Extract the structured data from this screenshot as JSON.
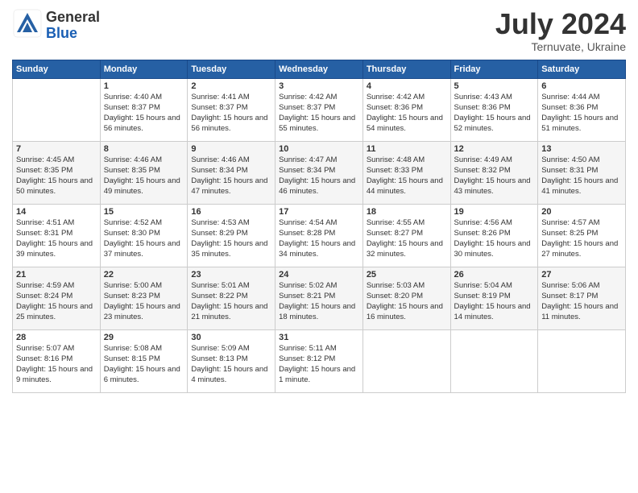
{
  "logo": {
    "general": "General",
    "blue": "Blue"
  },
  "title": {
    "month_year": "July 2024",
    "location": "Ternuvate, Ukraine"
  },
  "weekdays": [
    "Sunday",
    "Monday",
    "Tuesday",
    "Wednesday",
    "Thursday",
    "Friday",
    "Saturday"
  ],
  "weeks": [
    [
      {
        "day": "",
        "sunrise": "",
        "sunset": "",
        "daylight": ""
      },
      {
        "day": "1",
        "sunrise": "Sunrise: 4:40 AM",
        "sunset": "Sunset: 8:37 PM",
        "daylight": "Daylight: 15 hours and 56 minutes."
      },
      {
        "day": "2",
        "sunrise": "Sunrise: 4:41 AM",
        "sunset": "Sunset: 8:37 PM",
        "daylight": "Daylight: 15 hours and 56 minutes."
      },
      {
        "day": "3",
        "sunrise": "Sunrise: 4:42 AM",
        "sunset": "Sunset: 8:37 PM",
        "daylight": "Daylight: 15 hours and 55 minutes."
      },
      {
        "day": "4",
        "sunrise": "Sunrise: 4:42 AM",
        "sunset": "Sunset: 8:36 PM",
        "daylight": "Daylight: 15 hours and 54 minutes."
      },
      {
        "day": "5",
        "sunrise": "Sunrise: 4:43 AM",
        "sunset": "Sunset: 8:36 PM",
        "daylight": "Daylight: 15 hours and 52 minutes."
      },
      {
        "day": "6",
        "sunrise": "Sunrise: 4:44 AM",
        "sunset": "Sunset: 8:36 PM",
        "daylight": "Daylight: 15 hours and 51 minutes."
      }
    ],
    [
      {
        "day": "7",
        "sunrise": "Sunrise: 4:45 AM",
        "sunset": "Sunset: 8:35 PM",
        "daylight": "Daylight: 15 hours and 50 minutes."
      },
      {
        "day": "8",
        "sunrise": "Sunrise: 4:46 AM",
        "sunset": "Sunset: 8:35 PM",
        "daylight": "Daylight: 15 hours and 49 minutes."
      },
      {
        "day": "9",
        "sunrise": "Sunrise: 4:46 AM",
        "sunset": "Sunset: 8:34 PM",
        "daylight": "Daylight: 15 hours and 47 minutes."
      },
      {
        "day": "10",
        "sunrise": "Sunrise: 4:47 AM",
        "sunset": "Sunset: 8:34 PM",
        "daylight": "Daylight: 15 hours and 46 minutes."
      },
      {
        "day": "11",
        "sunrise": "Sunrise: 4:48 AM",
        "sunset": "Sunset: 8:33 PM",
        "daylight": "Daylight: 15 hours and 44 minutes."
      },
      {
        "day": "12",
        "sunrise": "Sunrise: 4:49 AM",
        "sunset": "Sunset: 8:32 PM",
        "daylight": "Daylight: 15 hours and 43 minutes."
      },
      {
        "day": "13",
        "sunrise": "Sunrise: 4:50 AM",
        "sunset": "Sunset: 8:31 PM",
        "daylight": "Daylight: 15 hours and 41 minutes."
      }
    ],
    [
      {
        "day": "14",
        "sunrise": "Sunrise: 4:51 AM",
        "sunset": "Sunset: 8:31 PM",
        "daylight": "Daylight: 15 hours and 39 minutes."
      },
      {
        "day": "15",
        "sunrise": "Sunrise: 4:52 AM",
        "sunset": "Sunset: 8:30 PM",
        "daylight": "Daylight: 15 hours and 37 minutes."
      },
      {
        "day": "16",
        "sunrise": "Sunrise: 4:53 AM",
        "sunset": "Sunset: 8:29 PM",
        "daylight": "Daylight: 15 hours and 35 minutes."
      },
      {
        "day": "17",
        "sunrise": "Sunrise: 4:54 AM",
        "sunset": "Sunset: 8:28 PM",
        "daylight": "Daylight: 15 hours and 34 minutes."
      },
      {
        "day": "18",
        "sunrise": "Sunrise: 4:55 AM",
        "sunset": "Sunset: 8:27 PM",
        "daylight": "Daylight: 15 hours and 32 minutes."
      },
      {
        "day": "19",
        "sunrise": "Sunrise: 4:56 AM",
        "sunset": "Sunset: 8:26 PM",
        "daylight": "Daylight: 15 hours and 30 minutes."
      },
      {
        "day": "20",
        "sunrise": "Sunrise: 4:57 AM",
        "sunset": "Sunset: 8:25 PM",
        "daylight": "Daylight: 15 hours and 27 minutes."
      }
    ],
    [
      {
        "day": "21",
        "sunrise": "Sunrise: 4:59 AM",
        "sunset": "Sunset: 8:24 PM",
        "daylight": "Daylight: 15 hours and 25 minutes."
      },
      {
        "day": "22",
        "sunrise": "Sunrise: 5:00 AM",
        "sunset": "Sunset: 8:23 PM",
        "daylight": "Daylight: 15 hours and 23 minutes."
      },
      {
        "day": "23",
        "sunrise": "Sunrise: 5:01 AM",
        "sunset": "Sunset: 8:22 PM",
        "daylight": "Daylight: 15 hours and 21 minutes."
      },
      {
        "day": "24",
        "sunrise": "Sunrise: 5:02 AM",
        "sunset": "Sunset: 8:21 PM",
        "daylight": "Daylight: 15 hours and 18 minutes."
      },
      {
        "day": "25",
        "sunrise": "Sunrise: 5:03 AM",
        "sunset": "Sunset: 8:20 PM",
        "daylight": "Daylight: 15 hours and 16 minutes."
      },
      {
        "day": "26",
        "sunrise": "Sunrise: 5:04 AM",
        "sunset": "Sunset: 8:19 PM",
        "daylight": "Daylight: 15 hours and 14 minutes."
      },
      {
        "day": "27",
        "sunrise": "Sunrise: 5:06 AM",
        "sunset": "Sunset: 8:17 PM",
        "daylight": "Daylight: 15 hours and 11 minutes."
      }
    ],
    [
      {
        "day": "28",
        "sunrise": "Sunrise: 5:07 AM",
        "sunset": "Sunset: 8:16 PM",
        "daylight": "Daylight: 15 hours and 9 minutes."
      },
      {
        "day": "29",
        "sunrise": "Sunrise: 5:08 AM",
        "sunset": "Sunset: 8:15 PM",
        "daylight": "Daylight: 15 hours and 6 minutes."
      },
      {
        "day": "30",
        "sunrise": "Sunrise: 5:09 AM",
        "sunset": "Sunset: 8:13 PM",
        "daylight": "Daylight: 15 hours and 4 minutes."
      },
      {
        "day": "31",
        "sunrise": "Sunrise: 5:11 AM",
        "sunset": "Sunset: 8:12 PM",
        "daylight": "Daylight: 15 hours and 1 minute."
      },
      {
        "day": "",
        "sunrise": "",
        "sunset": "",
        "daylight": ""
      },
      {
        "day": "",
        "sunrise": "",
        "sunset": "",
        "daylight": ""
      },
      {
        "day": "",
        "sunrise": "",
        "sunset": "",
        "daylight": ""
      }
    ]
  ]
}
